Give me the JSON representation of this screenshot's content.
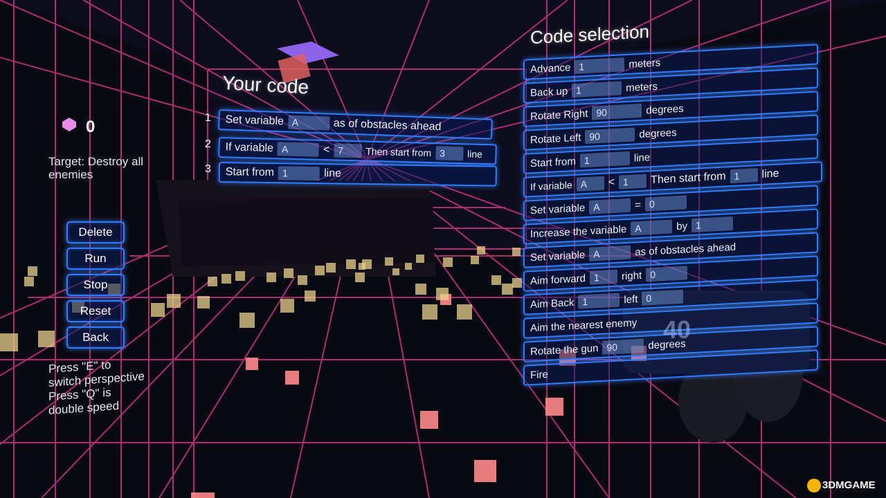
{
  "hud": {
    "gem_count": "0",
    "target_text": "Target: Destroy all enemies",
    "help_line1": "Press \"E\" to",
    "help_line2": "switch perspective",
    "help_line3": "Press \"Q\" is",
    "help_line4": "double speed",
    "buttons": [
      "Delete",
      "Run",
      "Stop",
      "Reset",
      "Back"
    ]
  },
  "your_code": {
    "title": "Your code",
    "lines": [
      {
        "num": "1",
        "label": "Set variable",
        "var": "A",
        "suffix": "as of obstacles ahead"
      },
      {
        "num": "2",
        "label": "If variable",
        "var": "A",
        "op": "<",
        "value": "7",
        "then": "Then start from",
        "line": "3",
        "line_label": "line"
      },
      {
        "num": "3",
        "label": "Start from",
        "value": "1",
        "suffix": "line"
      }
    ]
  },
  "code_selection": {
    "title": "Code selection",
    "items": {
      "advance": {
        "label": "Advance",
        "value": "1",
        "unit": "meters"
      },
      "backup": {
        "label": "Back up",
        "value": "1",
        "unit": "meters"
      },
      "rotate_right": {
        "label": "Rotate Right",
        "value": "90",
        "unit": "degrees"
      },
      "rotate_left": {
        "label": "Rotate Left",
        "value": "90",
        "unit": "degrees"
      },
      "start_from": {
        "label": "Start from",
        "value": "1",
        "unit": "line"
      },
      "if_var": {
        "label": "If variable",
        "var": "A",
        "op": "<",
        "value": "1",
        "then": "Then start from",
        "line": "1",
        "unit": "line"
      },
      "set_var": {
        "label": "Set variable",
        "var": "A",
        "op": "=",
        "value": "0"
      },
      "increase": {
        "label": "Increase the variable",
        "var": "A",
        "by": "by",
        "value": "1"
      },
      "set_obst": {
        "label": "Set variable",
        "var": "A",
        "suffix": "as of obstacles ahead"
      },
      "aim_forward": {
        "label": "Aim forward",
        "value": "1",
        "dir": "right",
        "value2": "0"
      },
      "aim_back": {
        "label": "Aim Back",
        "value": "1",
        "dir": "left",
        "value2": "0"
      },
      "aim_nearest": {
        "label": "Aim the nearest enemy"
      },
      "rotate_gun": {
        "label": "Rotate the gun",
        "value": "90",
        "unit": "degrees"
      },
      "fire": {
        "label": "Fire"
      }
    }
  },
  "overlay_number": "40",
  "watermark": "3DMGAME",
  "colors": {
    "grid": "#c2307e",
    "panel_border": "#2f7dff",
    "slot": "#7aa0e6",
    "cube_pink": "#ff8a8a",
    "cube_yellow": "#e8d28a"
  }
}
